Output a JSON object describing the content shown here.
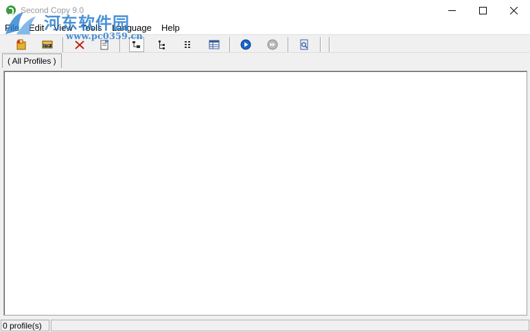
{
  "window": {
    "title": "Second Copy 9.0",
    "minimize_icon": "minimize-icon",
    "maximize_icon": "maximize-icon",
    "close_icon": "close-icon"
  },
  "watermark": {
    "title": "河东软件园",
    "url": "www.pc0359.cn"
  },
  "menu": {
    "items": [
      {
        "label": "File"
      },
      {
        "label": "Edit"
      },
      {
        "label": "View"
      },
      {
        "label": "Tools"
      },
      {
        "label": "Language"
      },
      {
        "label": "Help"
      }
    ]
  },
  "toolbar": {
    "buttons": [
      {
        "icon": "new-profile-icon"
      },
      {
        "icon": "ftp-icon"
      },
      {
        "icon": "delete-icon"
      },
      {
        "icon": "properties-icon"
      },
      {
        "icon": "view-tree-icon",
        "pressed": true
      },
      {
        "icon": "view-branch-icon"
      },
      {
        "icon": "view-list-icon"
      },
      {
        "icon": "view-details-icon"
      },
      {
        "icon": "run-icon"
      },
      {
        "icon": "run-all-icon"
      },
      {
        "icon": "log-viewer-icon"
      }
    ]
  },
  "tabs": [
    {
      "label": "(   All Profiles   )"
    }
  ],
  "status": {
    "profiles": "0 profile(s)"
  },
  "colors": {
    "accent_blue": "#1a66c9",
    "watermark_blue": "#2b7fd0",
    "app_green": "#3a9a3a"
  }
}
